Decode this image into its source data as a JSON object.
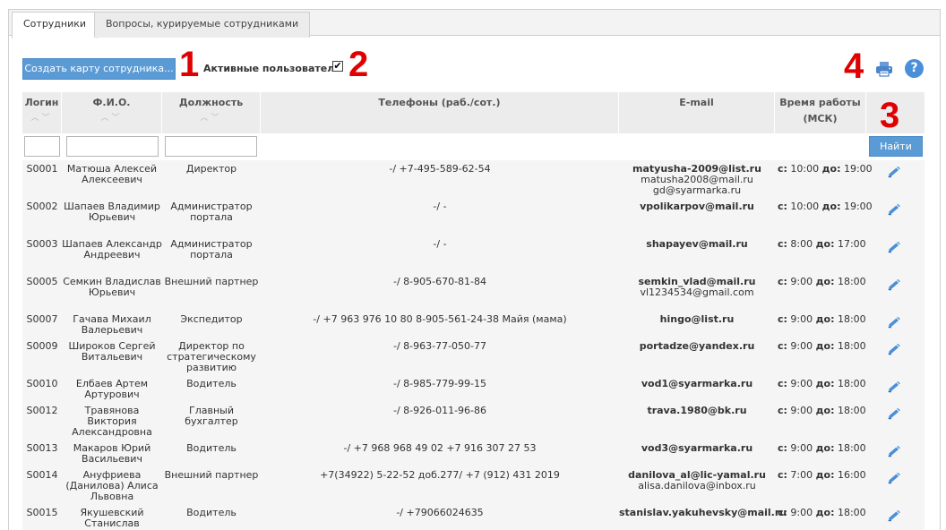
{
  "tabs": [
    {
      "label": "Сотрудники"
    },
    {
      "label": "Вопросы, курируемые сотрудниками"
    }
  ],
  "toolbar": {
    "create_label": "Создать карту сотрудника...",
    "active_users_label": "Активные пользователи",
    "active_users_checked": "✔",
    "help_label": "?"
  },
  "annotations": [
    "1",
    "2",
    "3",
    "4"
  ],
  "table": {
    "headers": {
      "login": "Логин",
      "fio": "Ф.И.О.",
      "position": "Должность",
      "phones": "Телефоны (раб./сот.)",
      "email": "E-mail",
      "time_line1": "Время работы",
      "time_line2": "(МСК)"
    },
    "sort_glyph": "︿﹀",
    "find_label": "Найти",
    "time_from": "с:",
    "time_to": "до:",
    "rows": [
      {
        "login": "S0001",
        "fio": "Матюша Алексей Алексеевич",
        "position": "Директор",
        "phones": "-/ +7-495-589-62-54",
        "email": "matyusha-2009@list.ru",
        "email_extra": [
          "matusha2008@mail.ru",
          "gd@syarmarka.ru"
        ],
        "from": "10:00",
        "to": "19:00"
      },
      {
        "login": "S0002",
        "fio": "Шапаев Владимир Юрьевич",
        "position": "Администратор портала",
        "phones": "-/ -",
        "email": "vpolikarpov@mail.ru",
        "email_extra": [],
        "from": "10:00",
        "to": "19:00"
      },
      {
        "login": "S0003",
        "fio": "Шапаев Александр Андреевич",
        "position": "Администратор портала",
        "phones": "-/ -",
        "email": "shapayev@mail.ru",
        "email_extra": [],
        "from": "8:00",
        "to": "17:00"
      },
      {
        "login": "S0005",
        "fio": "Семкин Владислав Юрьевич",
        "position": "Внешний партнер",
        "phones": "-/ 8-905-670-81-84",
        "email": "semkin_vlad@mail.ru",
        "email_extra": [
          "vl1234534@gmail.com"
        ],
        "from": "9:00",
        "to": "18:00"
      },
      {
        "login": "S0007",
        "fio": "Гачава Михаил Валерьевич",
        "position": "Экспедитор",
        "phones": "-/ +7 963 976 10 80 8-905-561-24-38 Майя (мама)",
        "email": "hingo@list.ru",
        "email_extra": [],
        "from": "9:00",
        "to": "18:00"
      },
      {
        "login": "S0009",
        "fio": "Широков Сергей Витальевич",
        "position": "Директор по стратегическому развитию",
        "phones": "-/ 8-963-77-050-77",
        "email": "portadze@yandex.ru",
        "email_extra": [],
        "from": "9:00",
        "to": "18:00"
      },
      {
        "login": "S0010",
        "fio": "Елбаев Артем Артурович",
        "position": "Водитель",
        "phones": "-/ 8-985-779-99-15",
        "email": "vod1@syarmarka.ru",
        "email_extra": [],
        "from": "9:00",
        "to": "18:00"
      },
      {
        "login": "S0012",
        "fio": "Травянова Виктория Александровна",
        "position": "Главный бухгалтер",
        "phones": "-/ 8-926-011-96-86",
        "email": "trava.1980@bk.ru",
        "email_extra": [],
        "from": "9:00",
        "to": "18:00"
      },
      {
        "login": "S0013",
        "fio": "Макаров Юрий Васильевич",
        "position": "Водитель",
        "phones": "-/ +7 968 968 49 02 +7 916 307 27 53",
        "email": "vod3@syarmarka.ru",
        "email_extra": [],
        "from": "9:00",
        "to": "18:00"
      },
      {
        "login": "S0014",
        "fio": "Ануфриева (Данилова) Алиса Львовна",
        "position": "Внешний партнер",
        "phones": "+7(34922) 5-22-52 доб.277/ +7 (912) 431 2019",
        "email": "danilova_al@lic-yamal.ru",
        "email_extra": [
          "alisa.danilova@inbox.ru"
        ],
        "from": "7:00",
        "to": "16:00"
      },
      {
        "login": "S0015",
        "fio": "Якушевский Станислав",
        "position": "Водитель",
        "phones": "-/ +79066024635",
        "email": "stanislav.yakuhevsky@mail.ru",
        "email_extra": [],
        "from": "9:00",
        "to": "18:00"
      }
    ]
  },
  "colors": {
    "accent": "#5b9bd5",
    "annotation": "#e00000",
    "edit_icon": "#4a8fd8"
  }
}
